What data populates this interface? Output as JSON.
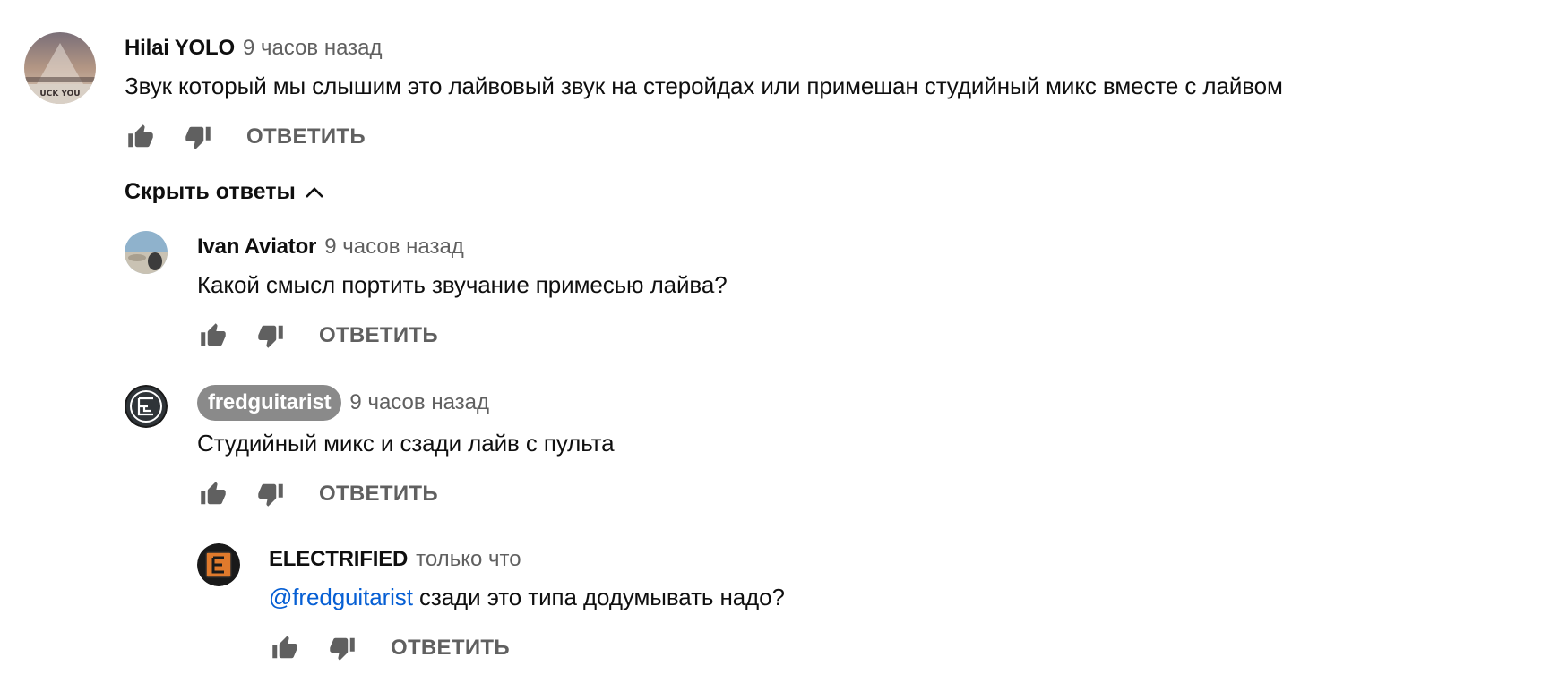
{
  "comments": [
    {
      "author": "Hilai YOLO",
      "time": "9 часов назад",
      "text": "Звук который мы слышим это лайвовый звук на стеройдах или примешан студийный микс вместе с лайвом",
      "avatar_text": "UCK YOU",
      "reply_label": "ОТВЕТИТЬ"
    },
    {
      "author": "Ivan Aviator",
      "time": "9 часов назад",
      "text": "Какой смысл портить звучание примесью лайва?",
      "reply_label": "ОТВЕТИТЬ"
    },
    {
      "author": "fredguitarist",
      "time": "9 часов назад",
      "text": "Студийный микс и сзади лайв с пульта",
      "reply_label": "ОТВЕТИТЬ"
    },
    {
      "author": "ELECTRIFIED",
      "time": "только что",
      "mention": "@fredguitarist",
      "text": " сзади это типа додумывать надо?",
      "reply_label": "ОТВЕТИТЬ"
    }
  ],
  "replies_toggle": {
    "label": "Скрыть ответы",
    "icon": "chevron-up-icon"
  },
  "colors": {
    "text": "#0f0f0f",
    "secondary": "#606060",
    "mention": "#065fd4",
    "badge": "#8a8a8a"
  }
}
